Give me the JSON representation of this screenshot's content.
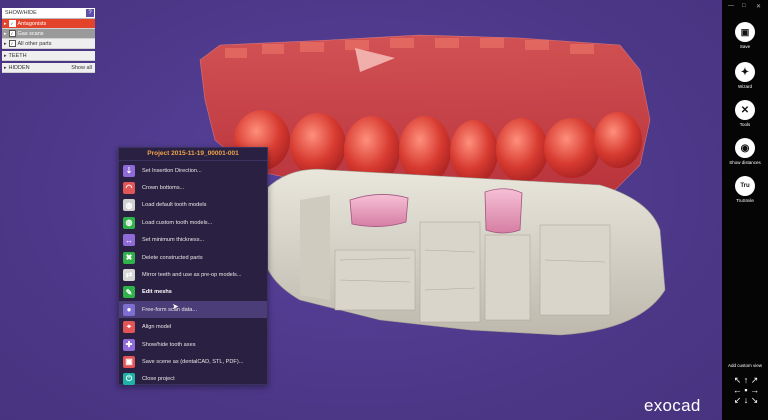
{
  "layer_panel": {
    "header": "SHOW/HIDE",
    "header_button": "?",
    "rows": [
      {
        "label": "Antagonists",
        "state": "active",
        "checked": true
      },
      {
        "label": "Gas scans",
        "state": "grey",
        "checked": true
      },
      {
        "label": "All other parts",
        "state": "normal",
        "checked": true
      }
    ],
    "teeth": "TEETH",
    "hidden": "HIDDEN",
    "show_all": "Show all"
  },
  "context_menu": {
    "title": "Project 2015-11-19_00001-001",
    "items": [
      {
        "label": "Set Insertion Direction...",
        "icon": "insertion-direction-icon",
        "color": "#8e6bd6"
      },
      {
        "label": "Crown bottoms...",
        "icon": "crown-bottom-icon",
        "color": "#e05555"
      },
      {
        "label": "Load default tooth models",
        "icon": "tooth-model-icon",
        "color": "#cfcfcf"
      },
      {
        "label": "Load custom tooth models...",
        "icon": "custom-tooth-icon",
        "color": "#2fb24a"
      },
      {
        "label": "Set minimum thickness...",
        "icon": "thickness-icon",
        "color": "#8e6bd6"
      },
      {
        "label": "Delete constructed parts",
        "icon": "delete-icon",
        "color": "#2fb24a"
      },
      {
        "label": "Mirror teeth and use as pre-op models...",
        "icon": "mirror-icon",
        "color": "#d6d6d6"
      },
      {
        "label": "Edit meshs",
        "icon": "edit-mesh-icon",
        "color": "#2fb24a",
        "section": true
      },
      {
        "label": "Free-form scan data...",
        "icon": "freeform-icon",
        "color": "#7c6fd0",
        "hover": true
      },
      {
        "label": "Align model",
        "icon": "align-model-icon",
        "color": "#e05555"
      },
      {
        "label": "Show/hide tooth axes",
        "icon": "tooth-axes-icon",
        "color": "#8e6bd6"
      },
      {
        "label": "Save scene as (dentalCAD, STL, PDF)...",
        "icon": "save-scene-icon",
        "color": "#e05555"
      },
      {
        "label": "Close project",
        "icon": "close-project-icon",
        "color": "#1fb3a8"
      }
    ]
  },
  "toolbar": {
    "window_controls": [
      "—",
      "□",
      "✕"
    ],
    "items": [
      {
        "label": "Save",
        "icon": "save-icon",
        "glyph": "💾"
      },
      {
        "label": "Wizard",
        "icon": "wizard-icon",
        "glyph": "✦"
      },
      {
        "label": "Tools",
        "icon": "tools-icon",
        "glyph": "✕"
      },
      {
        "label": "Show distances",
        "icon": "distances-icon",
        "glyph": "◉"
      },
      {
        "label": "TruSmile",
        "icon": "trusmile-icon",
        "glyph": "Tru"
      }
    ],
    "add_custom_view": "Add custom view"
  },
  "logo": "exocad"
}
